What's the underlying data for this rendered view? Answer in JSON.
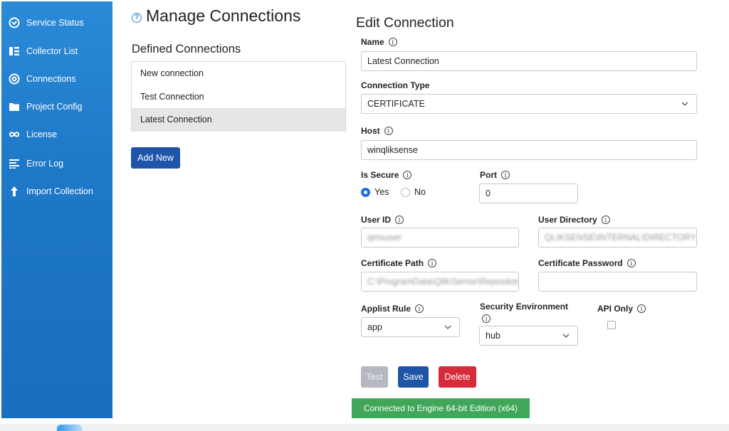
{
  "sidebar": {
    "items": [
      {
        "label": "Service Status",
        "icon": "service-status-icon"
      },
      {
        "label": "Collector List",
        "icon": "collector-list-icon"
      },
      {
        "label": "Connections",
        "icon": "connections-icon"
      },
      {
        "label": "Project Config",
        "icon": "folder-icon"
      },
      {
        "label": "License",
        "icon": "infinity-icon"
      },
      {
        "label": "Error Log",
        "icon": "error-log-icon"
      },
      {
        "label": "Import Collection",
        "icon": "arrow-up-icon"
      }
    ]
  },
  "page": {
    "title": "Manage Connections",
    "help_glyph": "?"
  },
  "connections": {
    "heading": "Defined Connections",
    "items": [
      "New connection",
      "Test Connection",
      "Latest Connection"
    ],
    "selected": "Latest Connection",
    "add_label": "Add New"
  },
  "form": {
    "heading": "Edit Connection",
    "info_glyph": "i",
    "name": {
      "label": "Name",
      "value": "Latest Connection"
    },
    "connection_type": {
      "label": "Connection Type",
      "value": "CERTIFICATE"
    },
    "host": {
      "label": "Host",
      "value": "winqliksense"
    },
    "is_secure": {
      "label": "Is Secure",
      "yes": "Yes",
      "no": "No",
      "value": "Yes"
    },
    "port": {
      "label": "Port",
      "value": "0"
    },
    "user_id": {
      "label": "User ID",
      "value": "qmsuser"
    },
    "user_directory": {
      "label": "User Directory",
      "value": "QLIKSENSE\\INTERNAL\\DIRECTORY"
    },
    "certificate_path": {
      "label": "Certificate Path",
      "value": "C:\\ProgramData\\Qlik\\Sense\\Repository\\..."
    },
    "certificate_password": {
      "label": "Certificate Password",
      "value": ""
    },
    "applist_rule": {
      "label": "Applist Rule",
      "value": "app"
    },
    "security_environment": {
      "label": "Security Environment",
      "value": "hub"
    },
    "api_only": {
      "label": "API Only",
      "checked": false
    },
    "test_label": "Test",
    "save_label": "Save",
    "delete_label": "Delete"
  },
  "status": {
    "text": "Connected to Engine 64-bit Edition (x64)",
    "color": "#3fa65a"
  },
  "colors": {
    "sidebar": "#1e78c8",
    "primary_button": "#1f55a8",
    "danger_button": "#d52b3a",
    "disabled_button": "#b5b8bc"
  }
}
